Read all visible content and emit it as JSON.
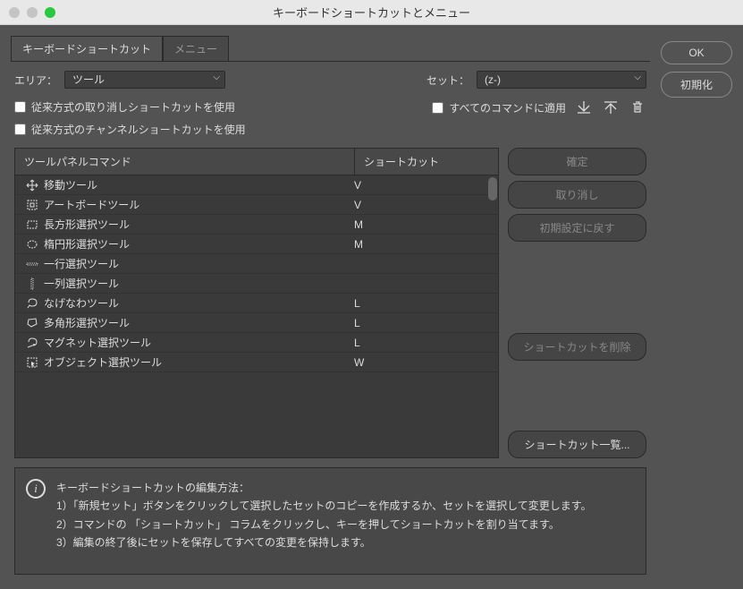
{
  "window": {
    "title": "キーボードショートカットとメニュー"
  },
  "tabs": [
    {
      "label": "キーボードショートカット",
      "active": true
    },
    {
      "label": "メニュー",
      "active": false
    }
  ],
  "area": {
    "label": "エリア：",
    "value": "ツール"
  },
  "set": {
    "label": "セット：",
    "value": "(z-)"
  },
  "checks": {
    "legacy_undo": "従来方式の取り消しショートカットを使用",
    "legacy_channel": "従来方式のチャンネルショートカットを使用",
    "apply_all": "すべてのコマンドに適用"
  },
  "table": {
    "header_cmd": "ツールパネルコマンド",
    "header_sc": "ショートカット",
    "rows": [
      {
        "cmd": "移動ツール",
        "sc": "V",
        "icon": "move"
      },
      {
        "cmd": "アートボードツール",
        "sc": "V",
        "icon": "artboard"
      },
      {
        "cmd": "長方形選択ツール",
        "sc": "M",
        "icon": "rect-marquee"
      },
      {
        "cmd": "楕円形選択ツール",
        "sc": "M",
        "icon": "ellipse-marquee"
      },
      {
        "cmd": "一行選択ツール",
        "sc": "",
        "icon": "row-marquee"
      },
      {
        "cmd": "一列選択ツール",
        "sc": "",
        "icon": "col-marquee"
      },
      {
        "cmd": "なげなわツール",
        "sc": "L",
        "icon": "lasso"
      },
      {
        "cmd": "多角形選択ツール",
        "sc": "L",
        "icon": "poly-lasso"
      },
      {
        "cmd": "マグネット選択ツール",
        "sc": "L",
        "icon": "magnetic-lasso"
      },
      {
        "cmd": "オブジェクト選択ツール",
        "sc": "W",
        "icon": "object-select"
      }
    ]
  },
  "side_buttons": {
    "confirm": "確定",
    "undo": "取り消し",
    "reset_default": "初期設定に戻す",
    "delete_shortcut": "ショートカットを削除",
    "shortcut_list": "ショートカット一覧..."
  },
  "info": {
    "heading": "キーボードショートカットの編集方法：",
    "line1": "1）「新規セット」ボタンをクリックして選択したセットのコピーを作成するか、セットを選択して変更します。",
    "line2": "2）コマンドの 「ショートカット」 コラムをクリックし、キーを押してショートカットを割り当てます。",
    "line3": "3）編集の終了後にセットを保存してすべての変更を保持します。"
  },
  "right": {
    "ok": "OK",
    "reset": "初期化"
  }
}
